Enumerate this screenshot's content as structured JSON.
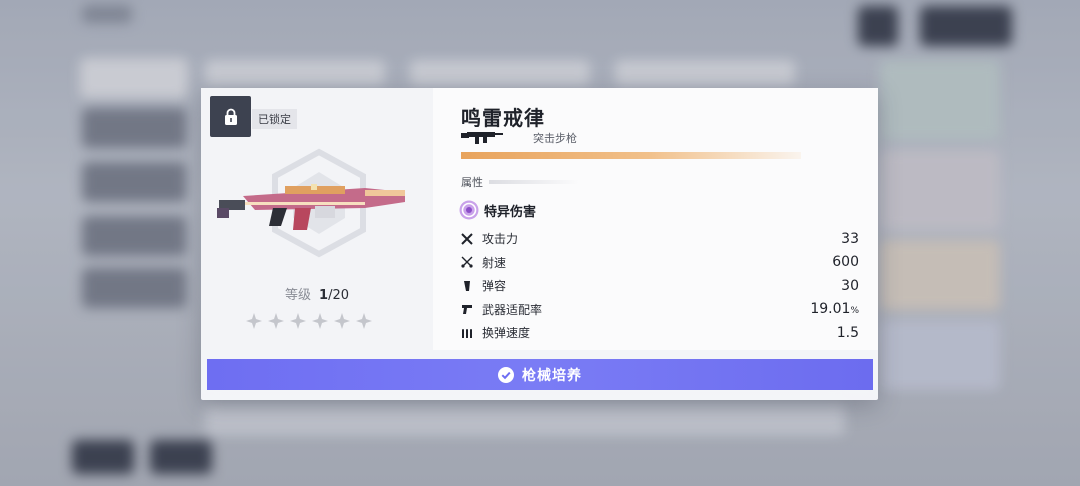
{
  "weapon": {
    "lock_label": "已锁定",
    "name": "鸣雷戒律",
    "type_label": "突击步枪",
    "level_label": "等级",
    "level_current": "1",
    "level_max": "/20",
    "stars_filled": 0,
    "stars_total": 6,
    "rarity_color": "#e8a35c"
  },
  "attributes": {
    "section_label": "属性",
    "damage_type": "特异伤害",
    "damage_type_color": "#a86ad8",
    "stats": [
      {
        "name": "攻击力",
        "value": "33",
        "icon": "crossed-swords-icon"
      },
      {
        "name": "射速",
        "value": "600",
        "icon": "crossed-blades-icon"
      },
      {
        "name": "弹容",
        "value": "30",
        "icon": "magazine-icon"
      },
      {
        "name": "武器适配率",
        "value": "19.01",
        "unit": "%",
        "icon": "pistol-icon"
      },
      {
        "name": "换弹速度",
        "value": "1.5",
        "icon": "bullets-icon"
      }
    ]
  },
  "actions": {
    "train_label": "枪械培养",
    "accent": "#6e6ef2"
  }
}
